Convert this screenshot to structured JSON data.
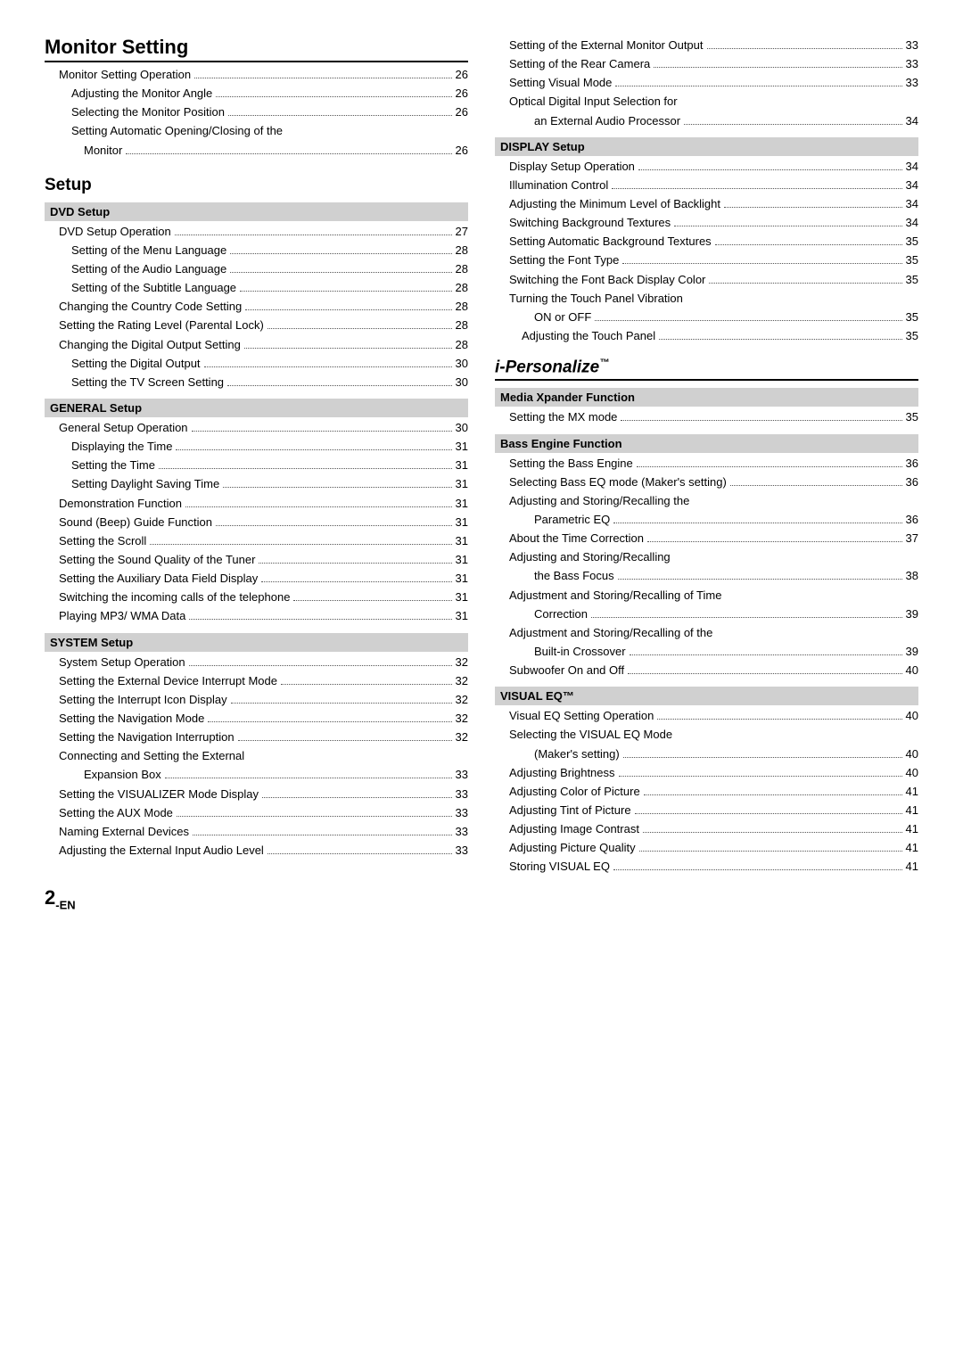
{
  "left_col": {
    "monitor_setting": {
      "title": "Monitor Setting",
      "entries": [
        {
          "label": "Monitor Setting Operation",
          "dots": true,
          "page": "26",
          "indent": 1
        },
        {
          "label": "Adjusting the Monitor Angle",
          "dots": true,
          "page": "26",
          "indent": 2
        },
        {
          "label": "Selecting the Monitor Position",
          "dots": true,
          "page": "26",
          "indent": 2
        },
        {
          "label": "Setting Automatic Opening/Closing of the",
          "dots": false,
          "page": "",
          "indent": 2
        },
        {
          "label": "Monitor",
          "dots": true,
          "page": "26",
          "indent": 3
        }
      ]
    },
    "setup": {
      "title": "Setup",
      "dvd": {
        "header": "DVD Setup",
        "entries": [
          {
            "label": "DVD Setup Operation",
            "dots": true,
            "page": "27",
            "indent": 1
          },
          {
            "label": "Setting of the Menu Language",
            "dots": true,
            "page": "28",
            "indent": 2
          },
          {
            "label": "Setting of the Audio Language",
            "dots": true,
            "page": "28",
            "indent": 2
          },
          {
            "label": "Setting of the Subtitle Language",
            "dots": true,
            "page": "28",
            "indent": 2
          },
          {
            "label": "Changing the Country Code Setting",
            "dots": true,
            "page": "28",
            "indent": 1
          },
          {
            "label": "Setting the Rating Level (Parental Lock)",
            "dots": true,
            "page": "28",
            "indent": 1
          },
          {
            "label": "Changing the Digital Output Setting",
            "dots": true,
            "page": "28",
            "indent": 1
          },
          {
            "label": "Setting the Digital Output",
            "dots": true,
            "page": "30",
            "indent": 2
          },
          {
            "label": "Setting the TV Screen Setting",
            "dots": true,
            "page": "30",
            "indent": 2
          }
        ]
      },
      "general": {
        "header": "GENERAL Setup",
        "entries": [
          {
            "label": "General Setup Operation",
            "dots": true,
            "page": "30",
            "indent": 1
          },
          {
            "label": "Displaying the Time",
            "dots": true,
            "page": "31",
            "indent": 2
          },
          {
            "label": "Setting the Time",
            "dots": true,
            "page": "31",
            "indent": 2
          },
          {
            "label": "Setting Daylight Saving Time",
            "dots": true,
            "page": "31",
            "indent": 2
          },
          {
            "label": "Demonstration Function",
            "dots": true,
            "page": "31",
            "indent": 1
          },
          {
            "label": "Sound (Beep) Guide Function",
            "dots": true,
            "page": "31",
            "indent": 1
          },
          {
            "label": "Setting the Scroll",
            "dots": true,
            "page": "31",
            "indent": 1
          },
          {
            "label": "Setting the Sound Quality of the Tuner",
            "dots": true,
            "page": "31",
            "indent": 1
          },
          {
            "label": "Setting the Auxiliary Data Field Display",
            "dots": true,
            "page": "31",
            "indent": 1
          },
          {
            "label": "Switching the incoming calls of the telephone",
            "dots": true,
            "page": "31",
            "indent": 1
          },
          {
            "label": "Playing MP3/ WMA Data",
            "dots": true,
            "page": "31",
            "indent": 1
          }
        ]
      },
      "system": {
        "header": "SYSTEM Setup",
        "entries": [
          {
            "label": "System Setup Operation",
            "dots": true,
            "page": "32",
            "indent": 1
          },
          {
            "label": "Setting the External Device Interrupt Mode",
            "dots": true,
            "page": "32",
            "indent": 1
          },
          {
            "label": "Setting the Interrupt Icon Display",
            "dots": true,
            "page": "32",
            "indent": 1
          },
          {
            "label": "Setting the Navigation Mode",
            "dots": true,
            "page": "32",
            "indent": 1
          },
          {
            "label": "Setting the Navigation Interruption",
            "dots": true,
            "page": "32",
            "indent": 1
          },
          {
            "label": "Connecting and Setting the External",
            "dots": false,
            "page": "",
            "indent": 1
          },
          {
            "label": "Expansion Box",
            "dots": true,
            "page": "33",
            "indent": 3
          },
          {
            "label": "Setting the VISUALIZER Mode Display",
            "dots": true,
            "page": "33",
            "indent": 1
          },
          {
            "label": "Setting the AUX Mode",
            "dots": true,
            "page": "33",
            "indent": 1
          },
          {
            "label": "Naming External Devices",
            "dots": true,
            "page": "33",
            "indent": 1
          },
          {
            "label": "Adjusting the External Input Audio Level",
            "dots": true,
            "page": "33",
            "indent": 1
          }
        ]
      }
    }
  },
  "right_col": {
    "monitor_entries": [
      {
        "label": "Setting of the External Monitor Output",
        "dots": true,
        "page": "33",
        "indent": 1
      },
      {
        "label": "Setting of the Rear Camera",
        "dots": true,
        "page": "33",
        "indent": 1
      },
      {
        "label": "Setting Visual Mode",
        "dots": true,
        "page": "33",
        "indent": 1
      },
      {
        "label": "Optical Digital Input Selection for",
        "dots": false,
        "page": "",
        "indent": 1
      },
      {
        "label": "an External Audio Processor",
        "dots": true,
        "page": "34",
        "indent": 3
      }
    ],
    "display": {
      "header": "DISPLAY Setup",
      "entries": [
        {
          "label": "Display Setup Operation",
          "dots": true,
          "page": "34",
          "indent": 1
        },
        {
          "label": "Illumination Control",
          "dots": true,
          "page": "34",
          "indent": 1
        },
        {
          "label": "Adjusting the Minimum Level of Backlight",
          "dots": true,
          "page": "34",
          "indent": 1
        },
        {
          "label": "Switching Background Textures",
          "dots": true,
          "page": "34",
          "indent": 1
        },
        {
          "label": "Setting Automatic Background Textures",
          "dots": true,
          "page": "35",
          "indent": 1
        },
        {
          "label": "Setting the Font Type",
          "dots": true,
          "page": "35",
          "indent": 1
        },
        {
          "label": "Switching the Font Back Display Color",
          "dots": true,
          "page": "35",
          "indent": 1
        },
        {
          "label": "Turning the Touch Panel Vibration",
          "dots": false,
          "page": "",
          "indent": 1
        },
        {
          "label": "ON or OFF",
          "dots": true,
          "page": "35",
          "indent": 3
        },
        {
          "label": "Adjusting the Touch Panel",
          "dots": true,
          "page": "35",
          "indent": 2
        }
      ]
    },
    "ipersonalize": {
      "title": "i-Personalize",
      "tm": "™",
      "media_xpander": {
        "header": "Media Xpander Function",
        "entries": [
          {
            "label": "Setting the MX mode",
            "dots": true,
            "page": "35",
            "indent": 1
          }
        ]
      },
      "bass_engine": {
        "header": "Bass Engine Function",
        "entries": [
          {
            "label": "Setting the Bass Engine",
            "dots": true,
            "page": "36",
            "indent": 1
          },
          {
            "label": "Selecting Bass EQ mode (Maker's setting)",
            "dots": true,
            "page": "36",
            "indent": 1
          },
          {
            "label": "Adjusting and Storing/Recalling the",
            "dots": false,
            "page": "",
            "indent": 1
          },
          {
            "label": "Parametric EQ",
            "dots": true,
            "page": "36",
            "indent": 3
          },
          {
            "label": "About the Time Correction",
            "dots": true,
            "page": "37",
            "indent": 1
          },
          {
            "label": "Adjusting and Storing/Recalling",
            "dots": false,
            "page": "",
            "indent": 1
          },
          {
            "label": "the Bass Focus",
            "dots": true,
            "page": "38",
            "indent": 3
          },
          {
            "label": "Adjustment and Storing/Recalling of Time",
            "dots": false,
            "page": "",
            "indent": 1
          },
          {
            "label": "Correction",
            "dots": true,
            "page": "39",
            "indent": 3
          },
          {
            "label": "Adjustment and Storing/Recalling of the",
            "dots": false,
            "page": "",
            "indent": 1
          },
          {
            "label": "Built-in Crossover",
            "dots": true,
            "page": "39",
            "indent": 3
          },
          {
            "label": "Subwoofer On and Off",
            "dots": true,
            "page": "40",
            "indent": 1
          }
        ]
      },
      "visual_eq": {
        "header": "VISUAL EQ™",
        "entries": [
          {
            "label": "Visual EQ Setting Operation",
            "dots": true,
            "page": "40",
            "indent": 1
          },
          {
            "label": "Selecting the VISUAL EQ Mode",
            "dots": false,
            "page": "",
            "indent": 1
          },
          {
            "label": "(Maker's setting)",
            "dots": true,
            "page": "40",
            "indent": 3
          },
          {
            "label": "Adjusting Brightness",
            "dots": true,
            "page": "40",
            "indent": 1
          },
          {
            "label": "Adjusting Color of Picture",
            "dots": true,
            "page": "41",
            "indent": 1
          },
          {
            "label": "Adjusting Tint of Picture",
            "dots": true,
            "page": "41",
            "indent": 1
          },
          {
            "label": "Adjusting Image Contrast",
            "dots": true,
            "page": "41",
            "indent": 1
          },
          {
            "label": "Adjusting Picture Quality",
            "dots": true,
            "page": "41",
            "indent": 1
          },
          {
            "label": "Storing VISUAL EQ",
            "dots": true,
            "page": "41",
            "indent": 1
          }
        ]
      }
    }
  },
  "footer": {
    "page": "2",
    "suffix": "-EN"
  }
}
